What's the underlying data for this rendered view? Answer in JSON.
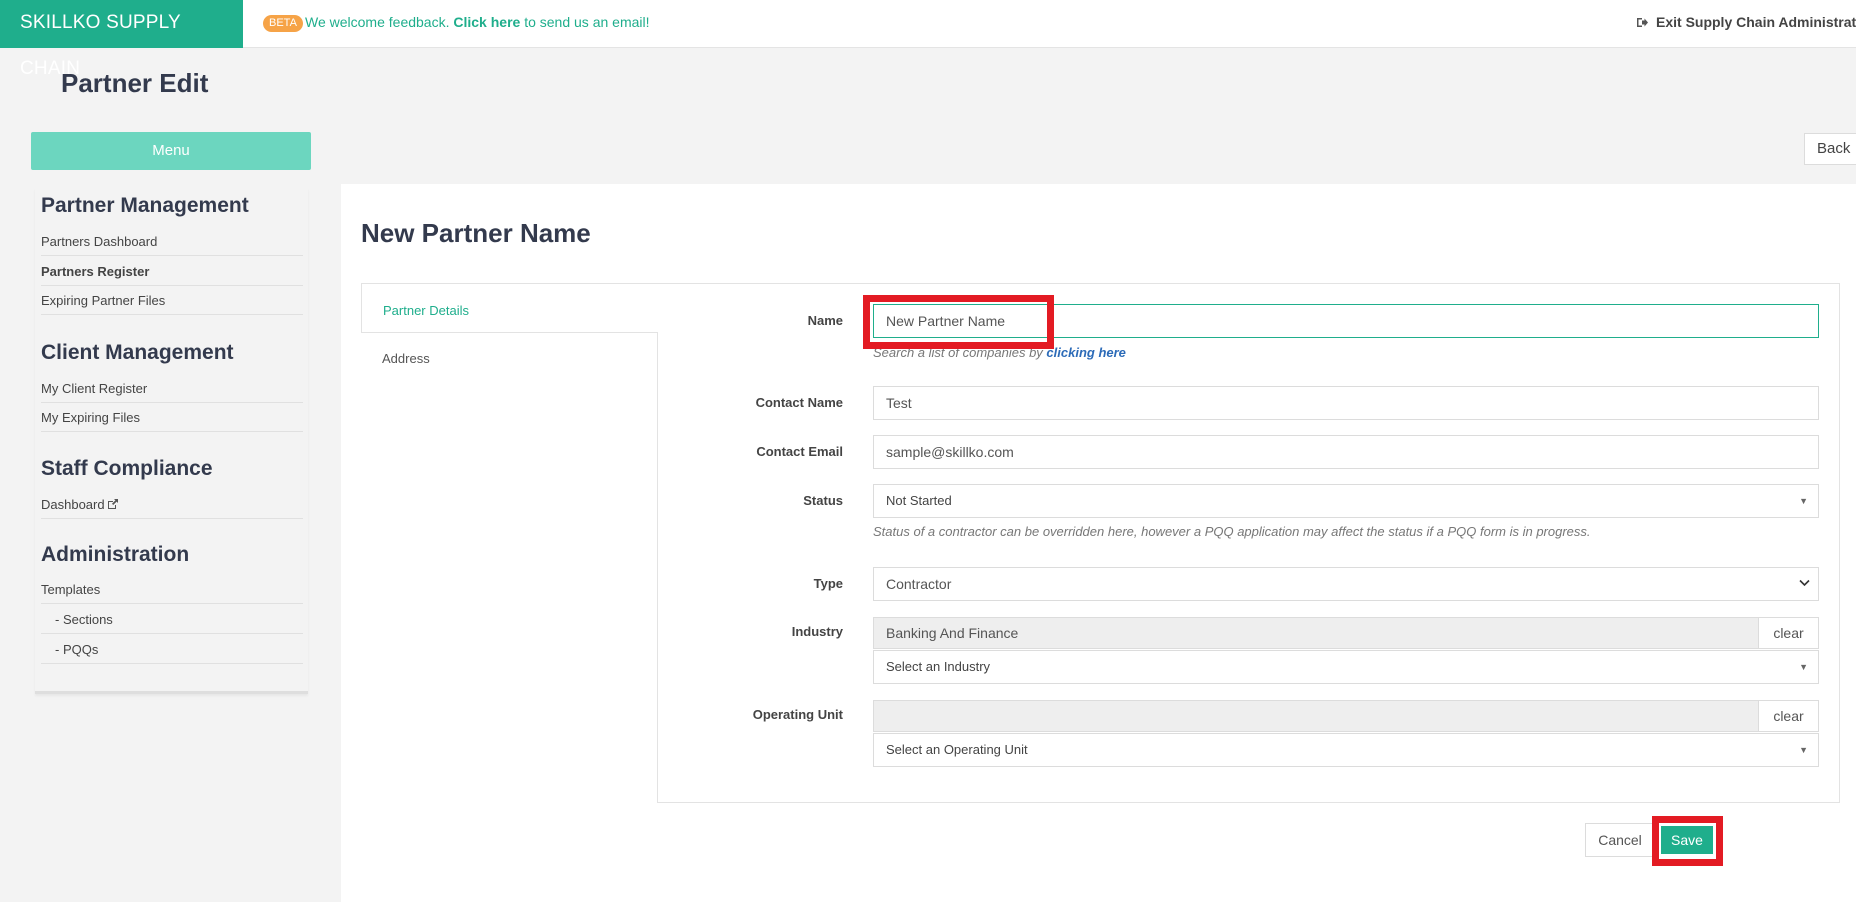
{
  "topbar": {
    "brand": "SKILLKO SUPPLY CHAIN",
    "beta_badge": "BETA",
    "feedback_prefix": "We welcome feedback. ",
    "feedback_link": "Click here",
    "feedback_suffix": " to send us an email!",
    "exit_label": "Exit Supply Chain Administrat"
  },
  "page": {
    "title": "Partner Edit"
  },
  "sidebar": {
    "menu_label": "Menu",
    "sections": [
      {
        "title": "Partner Management",
        "items": [
          "Partners Dashboard",
          "Partners Register",
          "Expiring Partner Files"
        ]
      },
      {
        "title": "Client Management",
        "items": [
          "My Client Register",
          "My Expiring Files"
        ]
      },
      {
        "title": "Staff Compliance",
        "items": [
          "Dashboard"
        ]
      },
      {
        "title": "Administration",
        "items": [
          "Templates",
          "- Sections",
          "- PQQs"
        ]
      }
    ]
  },
  "back_label": "Back",
  "partner": {
    "title": "New Partner Name",
    "tabs": [
      "Partner Details",
      "Address"
    ]
  },
  "form": {
    "name": {
      "label": "Name",
      "value": "New Partner Name",
      "hint_prefix": "Search a list of companies by ",
      "hint_link": "clicking here"
    },
    "contact_name": {
      "label": "Contact Name",
      "value": "Test"
    },
    "contact_email": {
      "label": "Contact Email",
      "value": "sample@skillko.com"
    },
    "status": {
      "label": "Status",
      "value": "Not Started",
      "hint": "Status of a contractor can be overridden here, however a PQQ application may affect the status if a PQQ form is in progress."
    },
    "type": {
      "label": "Type",
      "value": "Contractor"
    },
    "industry": {
      "label": "Industry",
      "value": "Banking And Finance",
      "clear_label": "clear",
      "select_placeholder": "Select an Industry"
    },
    "operating_unit": {
      "label": "Operating Unit",
      "value": "",
      "clear_label": "clear",
      "select_placeholder": "Select an Operating Unit"
    }
  },
  "actions": {
    "cancel_label": "Cancel",
    "save_label": "Save"
  },
  "colors": {
    "brand": "#1fae8c",
    "menu": "#6cd6bf",
    "beta": "#f6a347",
    "highlight": "#e31b23"
  }
}
